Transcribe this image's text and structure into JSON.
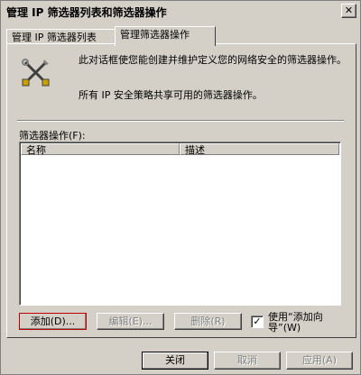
{
  "window": {
    "title": "管理 IP 筛选器列表和筛选器操作",
    "close_glyph": "✕"
  },
  "tabs": [
    {
      "label": "管理 IP 筛选器列表"
    },
    {
      "label": "管理筛选器操作"
    }
  ],
  "panel": {
    "icon": "tools-icon",
    "description": "此对话框使您能创建并维护定义您的网络安全的筛选器操作。",
    "description2": "所有 IP 安全策略共享可用的筛选器操作。",
    "list_label": "筛选器操作(F):",
    "columns": [
      "名称",
      "描述"
    ],
    "rows": []
  },
  "buttons": {
    "add": "添加(D)...",
    "edit": "编辑(E)...",
    "remove": "删除(R)",
    "wizard_checkbox_label": "使用“添加向导”(W)",
    "wizard_checked": "✓",
    "close": "关闭",
    "cancel": "取消",
    "apply": "应用(A)"
  },
  "colors": {
    "face": "#d4d0c8",
    "disabled_text": "#808080",
    "focus_outline": "#c00000"
  }
}
